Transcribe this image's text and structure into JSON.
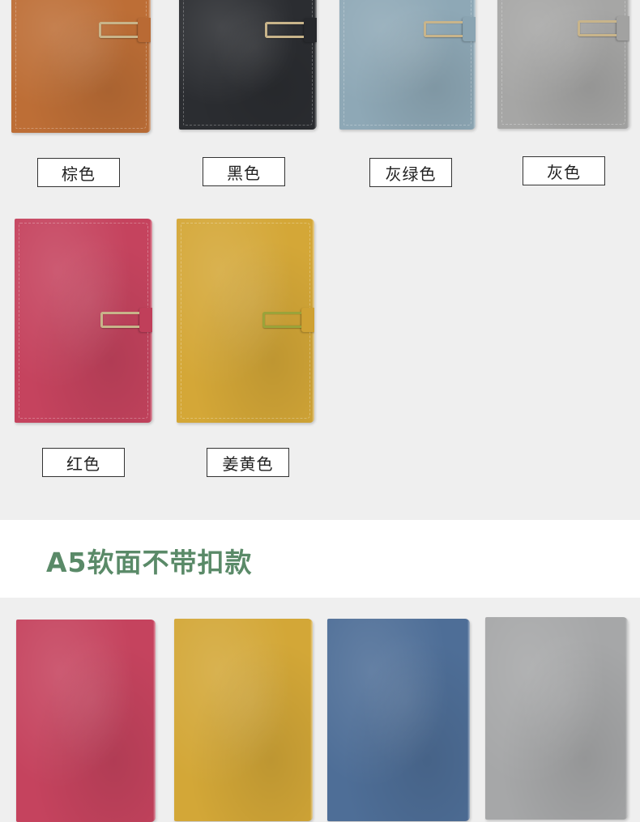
{
  "colors_top": [
    {
      "label": "棕色",
      "cover": "#bd6e36",
      "strap": "#b96a34"
    },
    {
      "label": "黑色",
      "cover": "#2b2d31",
      "strap": "#26282c"
    },
    {
      "label": "灰绿色",
      "cover": "#8ea8b6",
      "strap": "#8aa4b2"
    },
    {
      "label": "灰色",
      "cover": "#a6a6a5",
      "strap": "#a2a2a1"
    },
    {
      "label": "红色",
      "cover": "#c5435e",
      "strap": "#c03f5a"
    },
    {
      "label": "姜黄色",
      "cover": "#d4a737",
      "strap": "#cfa133"
    }
  ],
  "section_title": "A5软面不带扣款",
  "colors_bottom": [
    {
      "cover": "#c5435e"
    },
    {
      "cover": "#d3a737"
    },
    {
      "cover": "#4e6e97"
    },
    {
      "cover": "#a6a7a8"
    }
  ],
  "accent": {
    "title_color": "#5a8a68",
    "buckle_color": "#c8b48a",
    "buckle_green": "#9aa33a"
  }
}
